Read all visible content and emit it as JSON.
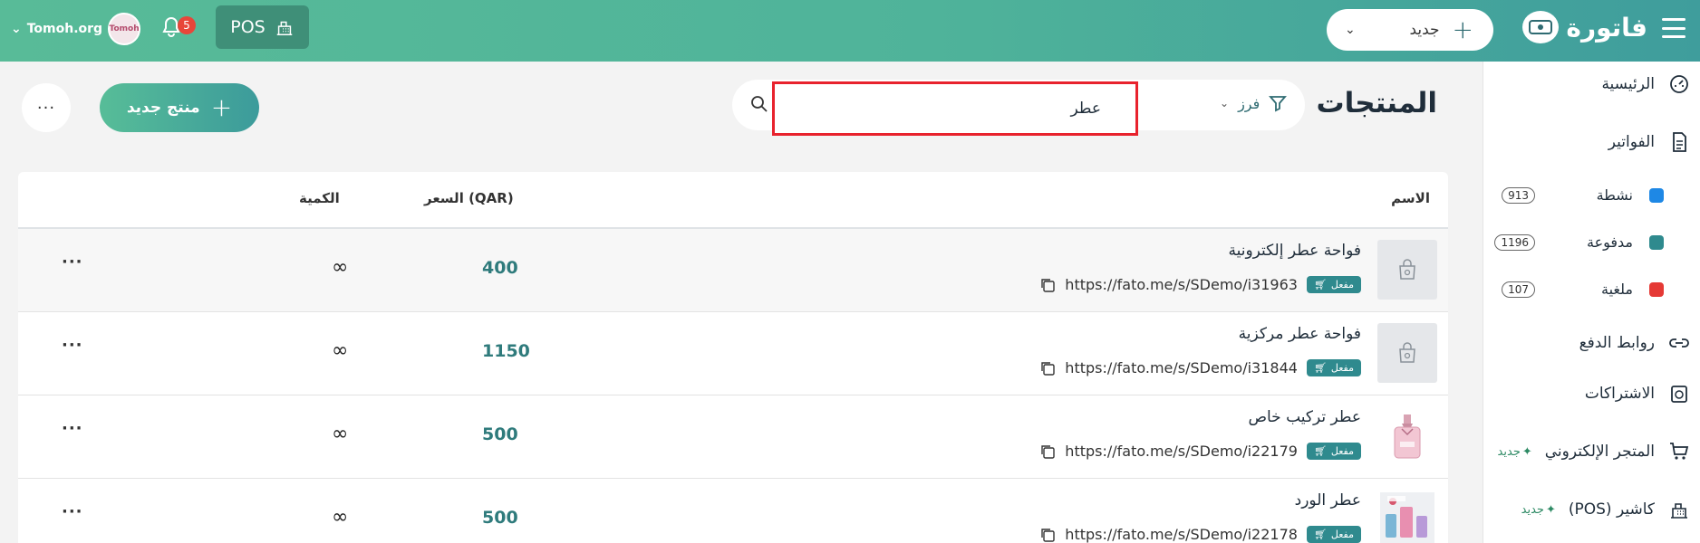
{
  "header": {
    "logo_text": "فاتورة",
    "new_button_label": "جديد",
    "pos_label": "POS",
    "notification_count": "5",
    "account_name": "Tomoh.org",
    "avatar_text": "Tomoh"
  },
  "sidebar": {
    "items": [
      {
        "label": "الرئيسية",
        "icon": "dashboard-icon"
      },
      {
        "label": "الفواتير",
        "icon": "document-icon"
      },
      {
        "label": "روابط الدفع",
        "icon": "link-icon"
      },
      {
        "label": "الاشتراكات",
        "icon": "subscription-icon"
      },
      {
        "label": "المتجر الإلكتروني",
        "icon": "cart-icon",
        "tag": "جديد"
      },
      {
        "label": "كاشير (POS)",
        "icon": "register-icon",
        "tag": "جديد"
      }
    ],
    "statuses": [
      {
        "label": "نشطة",
        "count": "913",
        "color": "#1e88e5"
      },
      {
        "label": "مدفوعة",
        "count": "1196",
        "color": "#2f8a8e"
      },
      {
        "label": "ملغية",
        "count": "107",
        "color": "#e53935"
      }
    ]
  },
  "main": {
    "title": "المنتجات",
    "search_value": "عطر",
    "filter_label": "فرز",
    "add_product_label": "منتج جديد",
    "more_label": "···"
  },
  "table": {
    "headers": {
      "name": "الاسم",
      "price": "السعر (QAR)",
      "quantity": "الكمية"
    },
    "rows": [
      {
        "name": "فواحة عطر إلكترونية",
        "link": "https://fato.me/s/SDemo/i31963",
        "status": "مفعل",
        "price": "400",
        "quantity": "∞",
        "thumb": "placeholder"
      },
      {
        "name": "فواحة عطر مركزية",
        "link": "https://fato.me/s/SDemo/i31844",
        "status": "مفعل",
        "price": "1150",
        "quantity": "∞",
        "thumb": "placeholder"
      },
      {
        "name": "عطر تركيب خاص",
        "link": "https://fato.me/s/SDemo/i22179",
        "status": "مفعل",
        "price": "500",
        "quantity": "∞",
        "thumb": "perfume"
      },
      {
        "name": "عطر الورد",
        "link": "https://fato.me/s/SDemo/i22178",
        "status": "مفعل",
        "price": "500",
        "quantity": "∞",
        "thumb": "perfume2"
      }
    ],
    "row_more_label": "···"
  },
  "colors": {
    "accent": "#4fb39a",
    "accent_dark": "#2f8a8e",
    "search_highlight": "#e8222d"
  }
}
